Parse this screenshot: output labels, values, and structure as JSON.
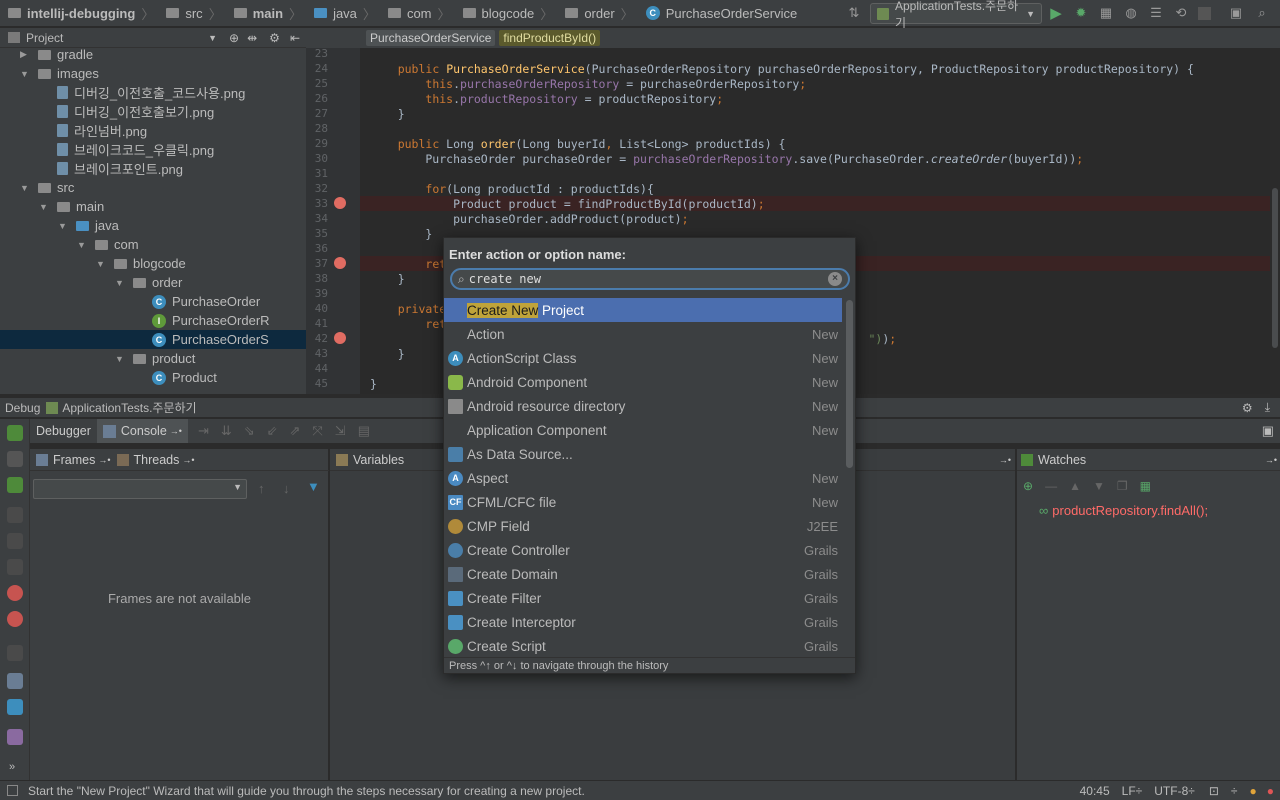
{
  "navbar": {
    "crumbs": [
      "intellij-debugging",
      "src",
      "main",
      "java",
      "com",
      "blogcode",
      "order",
      "PurchaseOrderService"
    ],
    "run_config": "ApplicationTests.주문하기"
  },
  "project": {
    "header": "Project",
    "tree": [
      {
        "label": "gradle",
        "kind": "folder",
        "level": 1,
        "arrow": "▶"
      },
      {
        "label": "images",
        "kind": "folder",
        "level": 1,
        "arrow": "▼"
      },
      {
        "label": "디버깅_이전호출_코드사용.png",
        "kind": "png",
        "level": 2
      },
      {
        "label": "디버깅_이전호출보기.png",
        "kind": "png",
        "level": 2
      },
      {
        "label": "라인넘버.png",
        "kind": "png",
        "level": 2
      },
      {
        "label": "브레이크코드_우클릭.png",
        "kind": "png",
        "level": 2
      },
      {
        "label": "브레이크포인트.png",
        "kind": "png",
        "level": 2
      },
      {
        "label": "src",
        "kind": "folder",
        "level": 1,
        "arrow": "▼"
      },
      {
        "label": "main",
        "kind": "folder",
        "level": 2,
        "arrow": "▼"
      },
      {
        "label": "java",
        "kind": "folder-blue",
        "level": 3,
        "arrow": "▼"
      },
      {
        "label": "com",
        "kind": "folder",
        "level": 4,
        "arrow": "▼"
      },
      {
        "label": "blogcode",
        "kind": "folder",
        "level": 5,
        "arrow": "▼"
      },
      {
        "label": "order",
        "kind": "folder",
        "level": 6,
        "arrow": "▼"
      },
      {
        "label": "PurchaseOrder",
        "kind": "class",
        "level": 7
      },
      {
        "label": "PurchaseOrderR",
        "kind": "interface",
        "level": 7
      },
      {
        "label": "PurchaseOrderS",
        "kind": "class",
        "level": 7,
        "selected": true
      },
      {
        "label": "product",
        "kind": "folder",
        "level": 6,
        "arrow": "▼"
      },
      {
        "label": "Product",
        "kind": "class",
        "level": 7
      }
    ]
  },
  "editor": {
    "tabs": [
      "PurchaseOrderService",
      "findProductById()"
    ],
    "line_numbers": [
      "23",
      "24",
      "25",
      "26",
      "27",
      "28",
      "29",
      "30",
      "31",
      "32",
      "33",
      "34",
      "35",
      "36",
      "37",
      "38",
      "39",
      "40",
      "41",
      "42",
      "43",
      "44",
      "45"
    ]
  },
  "debug": {
    "title": "Debug",
    "config": "ApplicationTests.주문하기",
    "tabs": [
      "Debugger",
      "Console"
    ],
    "frames_tab": "Frames",
    "threads_tab": "Threads",
    "frames_empty": "Frames are not available",
    "variables_title": "Variables",
    "watches_title": "Watches",
    "watch_expression": "productRepository.findAll();"
  },
  "popup": {
    "title": "Enter action or option name:",
    "search_value": "create new ",
    "items": [
      {
        "match": "Create New",
        "rest": " Project",
        "group": "",
        "icon": "none",
        "selected": true
      },
      {
        "match": "",
        "rest": "Action",
        "group": "New",
        "icon": "none"
      },
      {
        "match": "",
        "rest": "ActionScript Class",
        "group": "New",
        "icon": "actionscript"
      },
      {
        "match": "",
        "rest": "Android Component",
        "group": "New",
        "icon": "android"
      },
      {
        "match": "",
        "rest": "Android resource directory",
        "group": "New",
        "icon": "folder"
      },
      {
        "match": "",
        "rest": "Application Component",
        "group": "New",
        "icon": "none"
      },
      {
        "match": "",
        "rest": "As Data Source...",
        "group": "",
        "icon": "database"
      },
      {
        "match": "",
        "rest": "Aspect",
        "group": "New",
        "icon": "aspect"
      },
      {
        "match": "",
        "rest": "CFML/CFC file",
        "group": "New",
        "icon": "cfml"
      },
      {
        "match": "",
        "rest": "CMP Field",
        "group": "J2EE",
        "icon": "cmp"
      },
      {
        "match": "",
        "rest": "Create Controller",
        "group": "Grails",
        "icon": "controller"
      },
      {
        "match": "",
        "rest": "Create Domain",
        "group": "Grails",
        "icon": "domain"
      },
      {
        "match": "",
        "rest": "Create Filter",
        "group": "Grails",
        "icon": "filter"
      },
      {
        "match": "",
        "rest": "Create Interceptor",
        "group": "Grails",
        "icon": "filter"
      },
      {
        "match": "",
        "rest": "Create Script",
        "group": "Grails",
        "icon": "script"
      }
    ],
    "hint": "Press ^↑ or ^↓ to navigate through the history"
  },
  "status": {
    "message": "Start the \"New Project\" Wizard that will guide you through the steps necessary for creating a new project.",
    "position": "40:45",
    "line_sep": "LF÷",
    "encoding": "UTF-8÷"
  }
}
